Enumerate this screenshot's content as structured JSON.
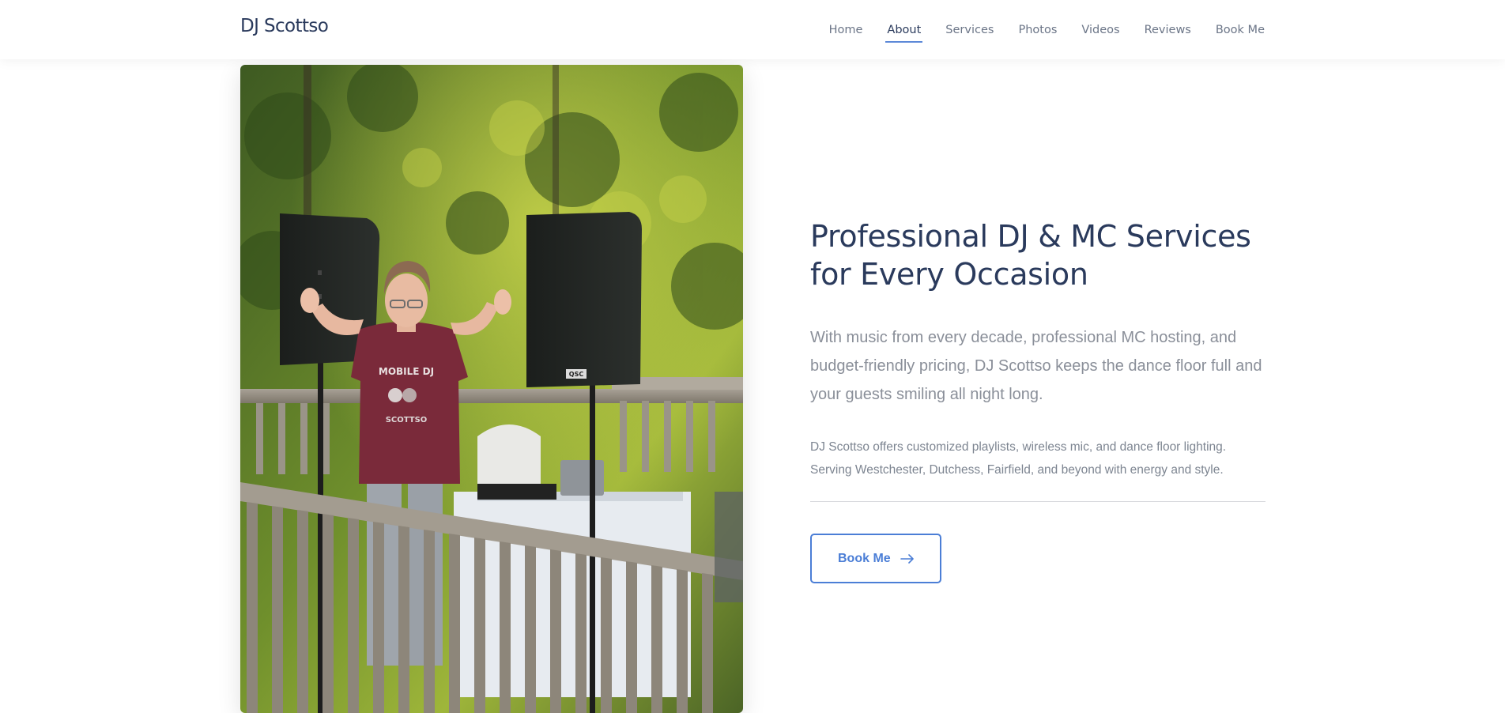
{
  "site": {
    "brand": "DJ Scottso"
  },
  "nav": {
    "items": [
      {
        "label": "Home"
      },
      {
        "label": "About"
      },
      {
        "label": "Services"
      },
      {
        "label": "Photos"
      },
      {
        "label": "Videos"
      },
      {
        "label": "Reviews"
      },
      {
        "label": "Book Me"
      }
    ],
    "active": "About"
  },
  "hero": {
    "headline_line1": "Professional DJ & MC Services",
    "headline_line2": "for Every Occasion",
    "lead_line1": "With music from every decade, professional MC hosting, and",
    "lead_line2": "budget-friendly pricing, DJ Scottso keeps the dance floor full and",
    "lead_line3": "your guests smiling all night long.",
    "details_line1": "DJ Scottso offers customized playlists, wireless mic, and dance floor lighting.",
    "details_line2": "Serving Westchester, Dutchess, Fairfield, and beyond with energy and style.",
    "cta_label": "Book Me",
    "cta_icon": "arrow-right-icon"
  },
  "photo": {
    "shirt_text_1": "MOBILE DJ",
    "shirt_text_2": "SCOTTSO",
    "speaker_badge": "QSC"
  },
  "colors": {
    "brand_text": "#2a3a5c",
    "nav_text": "#6b7587",
    "nav_active_underline": "#5d89d8",
    "accent": "#4b7ed6",
    "body_text": "#8a8f99"
  }
}
